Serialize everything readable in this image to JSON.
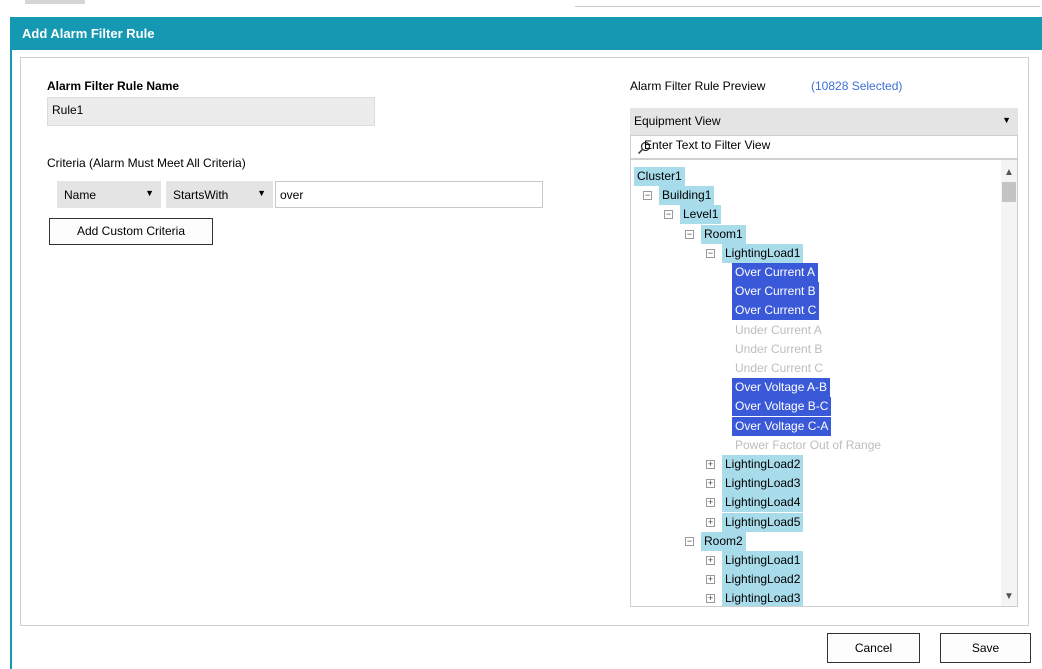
{
  "dialog": {
    "title": "Add Alarm Filter Rule"
  },
  "rule_name": {
    "label": "Alarm Filter Rule Name",
    "value": "Rule1"
  },
  "criteria": {
    "label": "Criteria (Alarm Must Meet All Criteria)",
    "field": "Name",
    "operator": "StartsWith",
    "value": "over",
    "add_button": "Add Custom Criteria"
  },
  "preview": {
    "label": "Alarm Filter Rule Preview",
    "selected_count": "(10828 Selected)",
    "selected_count_color": "#3b6fd6",
    "view": "Equipment View",
    "filter_placeholder": "Enter Text to Filter View"
  },
  "tree": [
    {
      "label": "Cluster1",
      "level": 0,
      "expander": "",
      "state": "partial"
    },
    {
      "label": "Building1",
      "level": 1,
      "expander": "minus",
      "state": "partial"
    },
    {
      "label": "Level1",
      "level": 2,
      "expander": "minus",
      "state": "partial"
    },
    {
      "label": "Room1",
      "level": 3,
      "expander": "minus",
      "state": "partial"
    },
    {
      "label": "LightingLoad1",
      "level": 4,
      "expander": "minus",
      "state": "partial"
    },
    {
      "label": "Over Current A",
      "level": 5,
      "expander": "",
      "state": "selected"
    },
    {
      "label": "Over Current B",
      "level": 5,
      "expander": "",
      "state": "selected"
    },
    {
      "label": "Over Current C",
      "level": 5,
      "expander": "",
      "state": "selected"
    },
    {
      "label": "Under Current A",
      "level": 5,
      "expander": "",
      "state": "off"
    },
    {
      "label": "Under Current B",
      "level": 5,
      "expander": "",
      "state": "off"
    },
    {
      "label": "Under Current C",
      "level": 5,
      "expander": "",
      "state": "off"
    },
    {
      "label": "Over Voltage A-B",
      "level": 5,
      "expander": "",
      "state": "selected"
    },
    {
      "label": "Over Voltage B-C",
      "level": 5,
      "expander": "",
      "state": "selected"
    },
    {
      "label": "Over Voltage C-A",
      "level": 5,
      "expander": "",
      "state": "selected"
    },
    {
      "label": "Power Factor Out of Range",
      "level": 5,
      "expander": "",
      "state": "off"
    },
    {
      "label": "LightingLoad2",
      "level": 4,
      "expander": "plus",
      "state": "partial"
    },
    {
      "label": "LightingLoad3",
      "level": 4,
      "expander": "plus",
      "state": "partial"
    },
    {
      "label": "LightingLoad4",
      "level": 4,
      "expander": "plus",
      "state": "partial"
    },
    {
      "label": "LightingLoad5",
      "level": 4,
      "expander": "plus",
      "state": "partial"
    },
    {
      "label": "Room2",
      "level": 3,
      "expander": "minus",
      "state": "partial"
    },
    {
      "label": "LightingLoad1",
      "level": 4,
      "expander": "plus",
      "state": "partial"
    },
    {
      "label": "LightingLoad2",
      "level": 4,
      "expander": "plus",
      "state": "partial"
    },
    {
      "label": "LightingLoad3",
      "level": 4,
      "expander": "plus",
      "state": "partial"
    }
  ],
  "buttons": {
    "cancel": "Cancel",
    "save": "Save"
  }
}
